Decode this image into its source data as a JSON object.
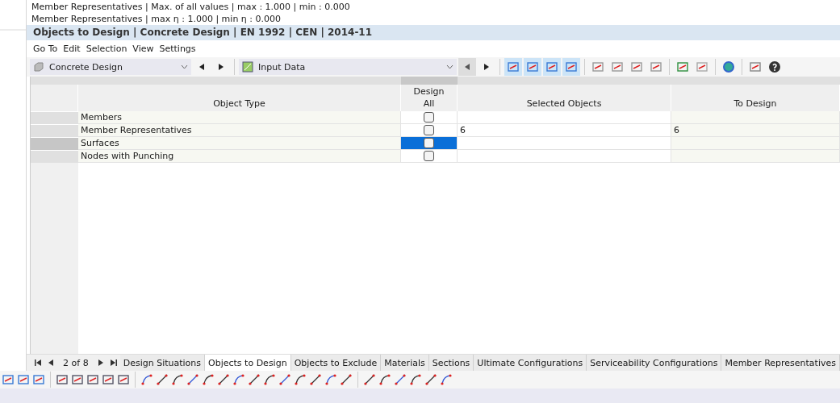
{
  "info_lines": [
    "Member Representatives | Max. of all values | max : 1.000 | min : 0.000",
    "Member Representatives | max η : 1.000 | min η : 0.000"
  ],
  "panel": {
    "title": "Objects to Design | Concrete Design | EN 1992 | CEN | 2014-11",
    "menu": [
      "Go To",
      "Edit",
      "Selection",
      "View",
      "Settings"
    ],
    "module_select": "Concrete Design",
    "table_select": "Input Data",
    "table": {
      "columns": [
        "Object Type",
        "Design\nAll",
        "Selected Objects",
        "To Design"
      ],
      "rows": [
        {
          "object_type": "Members",
          "design_all": false,
          "selected_objects": "",
          "to_design": "",
          "selected": false
        },
        {
          "object_type": "Member Representatives",
          "design_all": false,
          "selected_objects": "6",
          "to_design": "6",
          "selected": false
        },
        {
          "object_type": "Surfaces",
          "design_all": false,
          "selected_objects": "",
          "to_design": "",
          "selected": true
        },
        {
          "object_type": "Nodes with Punching",
          "design_all": false,
          "selected_objects": "",
          "to_design": "",
          "selected": false
        }
      ]
    },
    "pager": "2 of 8",
    "tabs": [
      {
        "label": "Design Situations",
        "selected": false
      },
      {
        "label": "Objects to Design",
        "selected": true
      },
      {
        "label": "Objects to Exclude",
        "selected": false
      },
      {
        "label": "Materials",
        "selected": false
      },
      {
        "label": "Sections",
        "selected": false
      },
      {
        "label": "Ultimate Configurations",
        "selected": false
      },
      {
        "label": "Serviceability Configurations",
        "selected": false
      },
      {
        "label": "Member Representatives",
        "selected": false
      }
    ]
  }
}
